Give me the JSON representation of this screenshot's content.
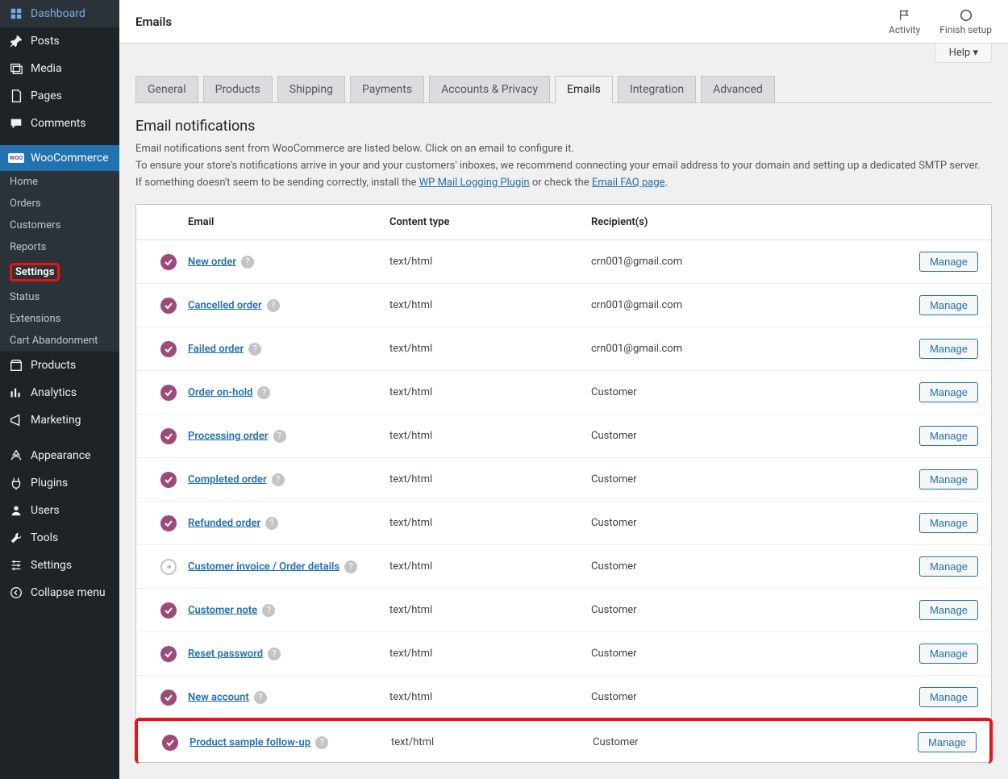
{
  "sidebar": {
    "items": [
      {
        "icon": "dashboard",
        "label": "Dashboard"
      },
      {
        "icon": "pin",
        "label": "Posts"
      },
      {
        "icon": "media",
        "label": "Media"
      },
      {
        "icon": "pages",
        "label": "Pages"
      },
      {
        "icon": "comment",
        "label": "Comments"
      },
      {
        "icon": "woo",
        "label": "WooCommerce",
        "current": true
      },
      {
        "icon": "products",
        "label": "Products"
      },
      {
        "icon": "analytics",
        "label": "Analytics"
      },
      {
        "icon": "marketing",
        "label": "Marketing"
      },
      {
        "icon": "appearance",
        "label": "Appearance"
      },
      {
        "icon": "plugins",
        "label": "Plugins"
      },
      {
        "icon": "users",
        "label": "Users"
      },
      {
        "icon": "tools",
        "label": "Tools"
      },
      {
        "icon": "settings",
        "label": "Settings"
      },
      {
        "icon": "collapse",
        "label": "Collapse menu"
      }
    ],
    "woo_sub": [
      "Home",
      "Orders",
      "Customers",
      "Reports",
      "Settings",
      "Status",
      "Extensions",
      "Cart Abandonment"
    ],
    "woo_sub_current": "Settings"
  },
  "topbar": {
    "title": "Emails",
    "activity": "Activity",
    "finish": "Finish setup",
    "help": "Help"
  },
  "tabs": [
    "General",
    "Products",
    "Shipping",
    "Payments",
    "Accounts & Privacy",
    "Emails",
    "Integration",
    "Advanced"
  ],
  "active_tab": "Emails",
  "section": {
    "title": "Email notifications",
    "desc1": "Email notifications sent from WooCommerce are listed below. Click on an email to configure it.",
    "desc2a": "To ensure your store's notifications arrive in your and your customers' inboxes, we recommend connecting your email address to your domain and setting up a dedicated SMTP server. If something doesn't seem to be sending correctly, install the ",
    "link1": "WP Mail Logging Plugin",
    "desc2b": " or check the ",
    "link2": "Email FAQ page",
    "desc2c": "."
  },
  "table": {
    "headers": {
      "email": "Email",
      "content_type": "Content type",
      "recipients": "Recipient(s)"
    },
    "manage_label": "Manage",
    "rows": [
      {
        "status": "enabled",
        "name": "New order",
        "ct": "text/html",
        "rec": "crn001@gmail.com"
      },
      {
        "status": "enabled",
        "name": "Cancelled order",
        "ct": "text/html",
        "rec": "crn001@gmail.com"
      },
      {
        "status": "enabled",
        "name": "Failed order",
        "ct": "text/html",
        "rec": "crn001@gmail.com"
      },
      {
        "status": "enabled",
        "name": "Order on-hold",
        "ct": "text/html",
        "rec": "Customer"
      },
      {
        "status": "enabled",
        "name": "Processing order",
        "ct": "text/html",
        "rec": "Customer"
      },
      {
        "status": "enabled",
        "name": "Completed order",
        "ct": "text/html",
        "rec": "Customer"
      },
      {
        "status": "enabled",
        "name": "Refunded order",
        "ct": "text/html",
        "rec": "Customer"
      },
      {
        "status": "manual",
        "name": "Customer invoice / Order details",
        "ct": "text/html",
        "rec": "Customer"
      },
      {
        "status": "enabled",
        "name": "Customer note",
        "ct": "text/html",
        "rec": "Customer"
      },
      {
        "status": "enabled",
        "name": "Reset password",
        "ct": "text/html",
        "rec": "Customer"
      },
      {
        "status": "enabled",
        "name": "New account",
        "ct": "text/html",
        "rec": "Customer"
      },
      {
        "status": "enabled",
        "name": "Product sample follow-up",
        "ct": "text/html",
        "rec": "Customer",
        "highlight": true
      }
    ]
  }
}
